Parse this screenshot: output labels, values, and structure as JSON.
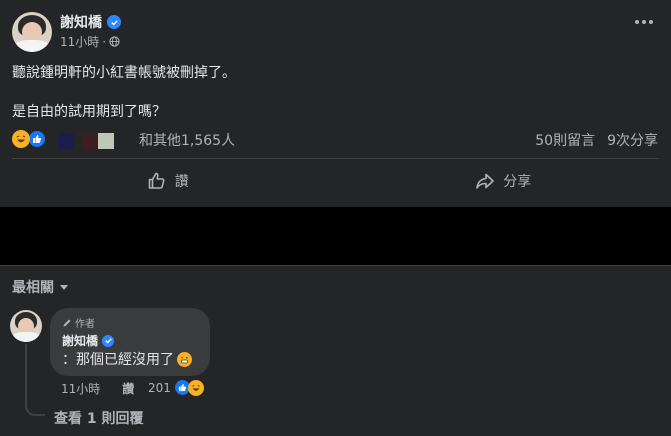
{
  "post": {
    "author": "謝知橋",
    "time": "11小時",
    "line1": "聽說鍾明軒的小紅書帳號被刪掉了。",
    "line2": "是自由的試用期到了嗎？",
    "reactions_others": "和其他1,565人",
    "comments_count": "50則留言",
    "shares_count": "9次分享",
    "like_label": "讚",
    "share_label": "分享",
    "icons": [
      "verified-icon",
      "globe-icon",
      "more-icon",
      "haha-icon",
      "like-icon",
      "thumbs-up-icon",
      "share-arrow-icon"
    ]
  },
  "comments": {
    "sort_label": "最相關",
    "comment": {
      "badge": "作者",
      "author": "謝知橋",
      "text": "：那個已經沒用了",
      "time": "11小時",
      "like_label": "讚",
      "reaction_count": "201"
    },
    "view_replies": "查看 1 則回覆"
  },
  "colors": {
    "background": "#242526",
    "text": "#e4e6eb",
    "secondary": "#b0b3b8",
    "bubble": "#3a3b3c",
    "accent": "#1877f2"
  }
}
